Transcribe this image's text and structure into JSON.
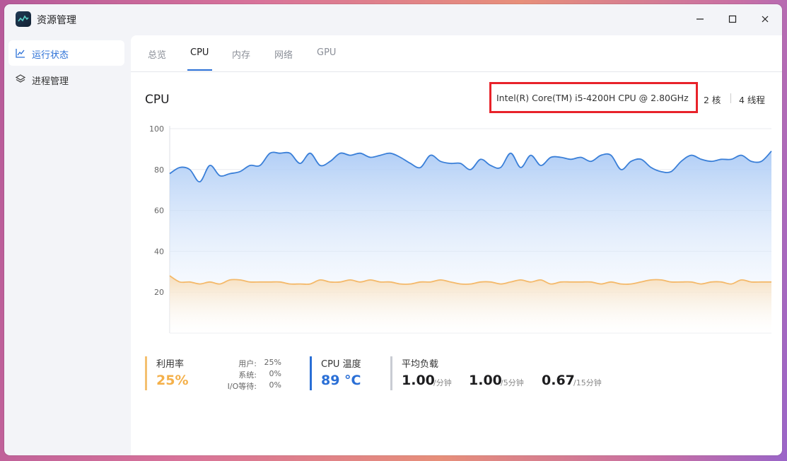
{
  "window": {
    "title": "资源管理",
    "controls": {
      "minimize": "minimize-icon",
      "maximize": "maximize-icon",
      "close": "close-icon"
    }
  },
  "sidebar": {
    "items": [
      {
        "label": "运行状态",
        "icon": "line-chart-icon",
        "active": true
      },
      {
        "label": "进程管理",
        "icon": "layers-icon",
        "active": false
      }
    ]
  },
  "tabs": [
    {
      "label": "总览",
      "active": false
    },
    {
      "label": "CPU",
      "active": true
    },
    {
      "label": "内存",
      "active": false
    },
    {
      "label": "网络",
      "active": false
    },
    {
      "label": "GPU",
      "active": false
    }
  ],
  "cpu": {
    "title": "CPU",
    "model": "Intel(R) Core(TM) i5-4200H CPU @ 2.80GHz",
    "cores": "2 核",
    "threads": "4 线程"
  },
  "chart_data": {
    "type": "area",
    "ylim": [
      0,
      100
    ],
    "yticks": [
      "100",
      "80",
      "60",
      "40",
      "20"
    ],
    "colors": {
      "series1": "#3a7fd8",
      "series2": "#f4b96a"
    },
    "series": [
      {
        "values": [
          78,
          81,
          80,
          74,
          82,
          77,
          78,
          79,
          82,
          82,
          88,
          88,
          88,
          83,
          88,
          82,
          84,
          88,
          87,
          88,
          86,
          87,
          88,
          86,
          83,
          81,
          87,
          84,
          83,
          83,
          80,
          85,
          82,
          81,
          88,
          81,
          87,
          82,
          86,
          86,
          85,
          86,
          84,
          87,
          87,
          80,
          84,
          85,
          81,
          79,
          79,
          84,
          87,
          85,
          84,
          85,
          85,
          87,
          84,
          84,
          89
        ]
      },
      {
        "values": [
          28,
          25,
          25,
          24,
          25,
          24,
          26,
          26,
          25,
          25,
          25,
          25,
          24,
          24,
          24,
          26,
          25,
          25,
          26,
          25,
          26,
          25,
          25,
          24,
          24,
          25,
          25,
          26,
          25,
          24,
          24,
          25,
          25,
          24,
          25,
          26,
          25,
          26,
          24,
          25,
          25,
          25,
          25,
          24,
          25,
          24,
          24,
          25,
          26,
          26,
          25,
          25,
          25,
          24,
          25,
          25,
          24,
          26,
          25,
          25,
          25
        ]
      }
    ]
  },
  "stats": {
    "usage": {
      "label": "利用率",
      "value": "25%",
      "color": "#f4b04a"
    },
    "breakdown": [
      {
        "label": "用户:",
        "value": "25%"
      },
      {
        "label": "系统:",
        "value": "0%"
      },
      {
        "label": "I/O等待:",
        "value": "0%"
      }
    ],
    "temperature": {
      "label": "CPU 温度",
      "value": "89 °C",
      "color": "#2a6fd6"
    },
    "load": {
      "label": "平均负载",
      "items": [
        {
          "value": "1.00",
          "unit": "/分钟"
        },
        {
          "value": "1.00",
          "unit": "/5分钟"
        },
        {
          "value": "0.67",
          "unit": "/15分钟"
        }
      ]
    }
  }
}
